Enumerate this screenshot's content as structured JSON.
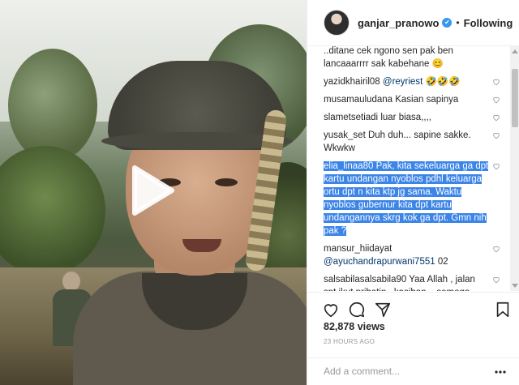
{
  "header": {
    "username": "ganjar_pranowo",
    "separator": "•",
    "follow_status": "Following"
  },
  "comments": [
    {
      "user": "",
      "text": "..ditane cek ngono sen pak ben lancaaarrrr sak kabehane 😊",
      "cut_top": true
    },
    {
      "user": "yazidkhairil08",
      "mention": "@reyriest",
      "text": " 🤣🤣🤣"
    },
    {
      "user": "musamauludana",
      "text": "Kasian sapinya"
    },
    {
      "user": "slametsetiadi",
      "text": "luar biasa,,,,"
    },
    {
      "user": "yusak_set",
      "text": "Duh duh... sapine sakke. Wkwkw"
    },
    {
      "user": "elia_linaa80",
      "text": "Pak, kita sekeluarga ga dpt kartu undangan nyoblos pdhl keluarga ortu dpt n kita ktp jg sama. Waktu nyoblos gubernur kita dpt kartu undangannya skrg kok ga dpt. Gmn nih pak ?",
      "highlighted": true
    },
    {
      "user": "mansur_hiidayat",
      "mention": "@ayuchandrapurwani7551",
      "text": " 02"
    },
    {
      "user": "salsabilasalsabila90",
      "text": "Yaa Allah , jalan spt ikut prihatin , kasihan ,,,semoga tetep semangaaat bpk\" tuk Negeri Tercinta Indonesia ,,,🖤"
    }
  ],
  "likes": "82,878 views",
  "time_ago": "23 HOURS AGO",
  "add_comment_placeholder": "Add a comment...",
  "icons": {
    "play": "play-icon",
    "verified": "verified-badge-icon",
    "heart": "heart-icon",
    "comment": "comment-icon",
    "share": "share-icon",
    "bookmark": "bookmark-icon",
    "more": "more-icon"
  },
  "colors": {
    "highlight": "#3b84e8",
    "verified": "#3897f0",
    "link": "#003569"
  }
}
